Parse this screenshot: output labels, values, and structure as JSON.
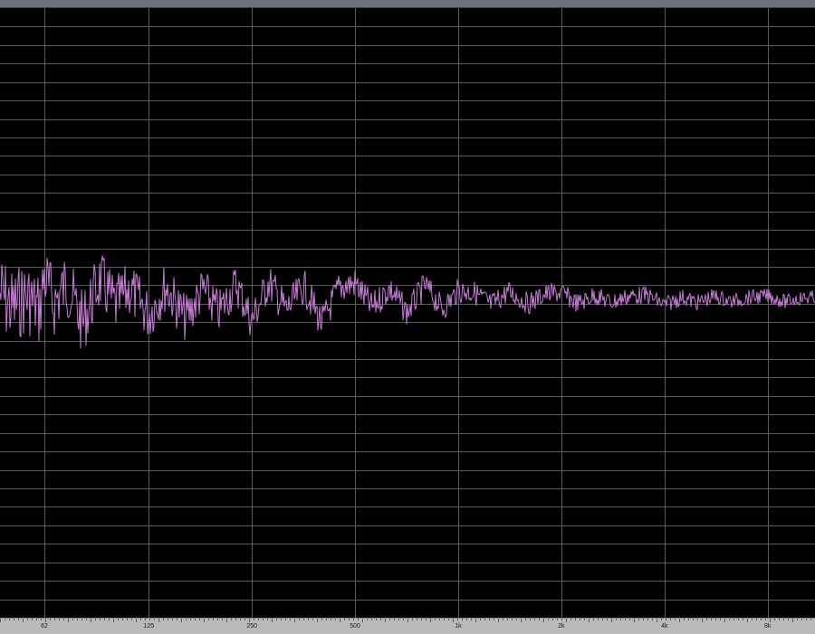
{
  "colors": {
    "background": "#000000",
    "grid": "#5a5a5a",
    "trace": "#c67bd6",
    "ruler": "#b9b9b9"
  },
  "frequency_axis": {
    "labels": [
      "62",
      "125",
      "250",
      "500",
      "1k",
      "2k",
      "4k",
      "8k"
    ],
    "values_hz": [
      62,
      125,
      250,
      500,
      1000,
      2000,
      4000,
      8000
    ]
  },
  "chart_data": {
    "type": "line",
    "xlabel": "",
    "ylabel": "",
    "xscale": "log",
    "xlim": [
      46,
      11000
    ],
    "grid": true,
    "series": [
      {
        "values_note": "",
        "x": [
          46,
          50,
          55,
          60,
          62,
          66,
          72,
          80,
          90,
          100,
          110,
          125,
          140,
          160,
          180,
          200,
          225,
          250,
          280,
          315,
          355,
          400,
          450,
          500,
          560,
          630,
          710,
          800,
          900,
          1000,
          1120,
          1250,
          1400,
          1600,
          1800,
          2000,
          2240,
          2500,
          2800,
          3150,
          3550,
          4000,
          4500,
          5000,
          5600,
          6300,
          7100,
          8000,
          9000,
          10000,
          11000
        ],
        "y": [
          5,
          -8,
          3,
          -10,
          22,
          -4,
          15,
          -22,
          18,
          -6,
          10,
          -14,
          12,
          -18,
          9,
          -12,
          14,
          -20,
          16,
          -10,
          12,
          -22,
          11,
          15,
          -8,
          10,
          -12,
          13,
          -9,
          8,
          6,
          -5,
          7,
          -4,
          5,
          6,
          -4,
          4,
          -3,
          3,
          4,
          -5,
          2,
          -3,
          3,
          -2,
          2,
          3,
          -2,
          1,
          2
        ]
      }
    ]
  }
}
